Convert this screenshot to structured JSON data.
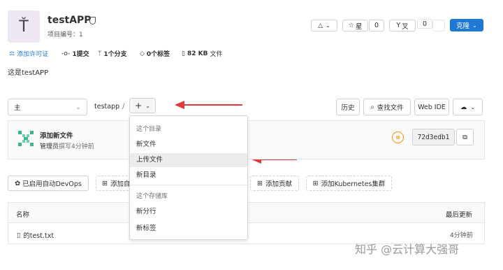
{
  "project": {
    "avatar_letter": "Ť",
    "name": "testAPP",
    "id_label": "项目编号：1",
    "description": "这是testAPP"
  },
  "header_actions": {
    "notification_icon": "bell-icon",
    "star_label": "星",
    "star_count": "0",
    "fork_label": "叉",
    "fork_count": "0",
    "clone_label": "克隆"
  },
  "stats": {
    "license": "添加许可证",
    "commits": "1提交",
    "branches": "1个分支",
    "tags": "0个标签",
    "size": "82 KB",
    "size_suffix": "文件"
  },
  "toolbar": {
    "branch": "主",
    "path": "testapp",
    "separator": "/",
    "add_label": "+",
    "history": "历史",
    "find_file": "查找文件",
    "web_ide": "Web IDE"
  },
  "dropdown": {
    "section1": "这个目录",
    "new_file": "新文件",
    "upload_file": "上传文件",
    "new_dir": "新目录",
    "section2": "这个存储库",
    "new_branch": "新分行",
    "new_tag": "新标签"
  },
  "commit": {
    "title": "添加新文件",
    "author": "管理员",
    "time": "撰写4分钟前",
    "sha": "72d3edb1"
  },
  "quick_actions": {
    "devops": "已启用自动DevOps",
    "add_readme": "添加自",
    "add_contrib": "添加贡献",
    "add_k8s": "添加Kubernetes集群"
  },
  "table": {
    "col_name": "名称",
    "col_updated": "最后更新",
    "rows": [
      {
        "name": "的test.txt",
        "updated": "4分钟前"
      }
    ]
  },
  "watermark": "知乎 @云计算大强哥",
  "colors": {
    "clone_bg": "#1f78d1",
    "arrow": "#e03a3a",
    "pipeline": "#fc9403",
    "avatar_bg": "#eee6f3"
  }
}
